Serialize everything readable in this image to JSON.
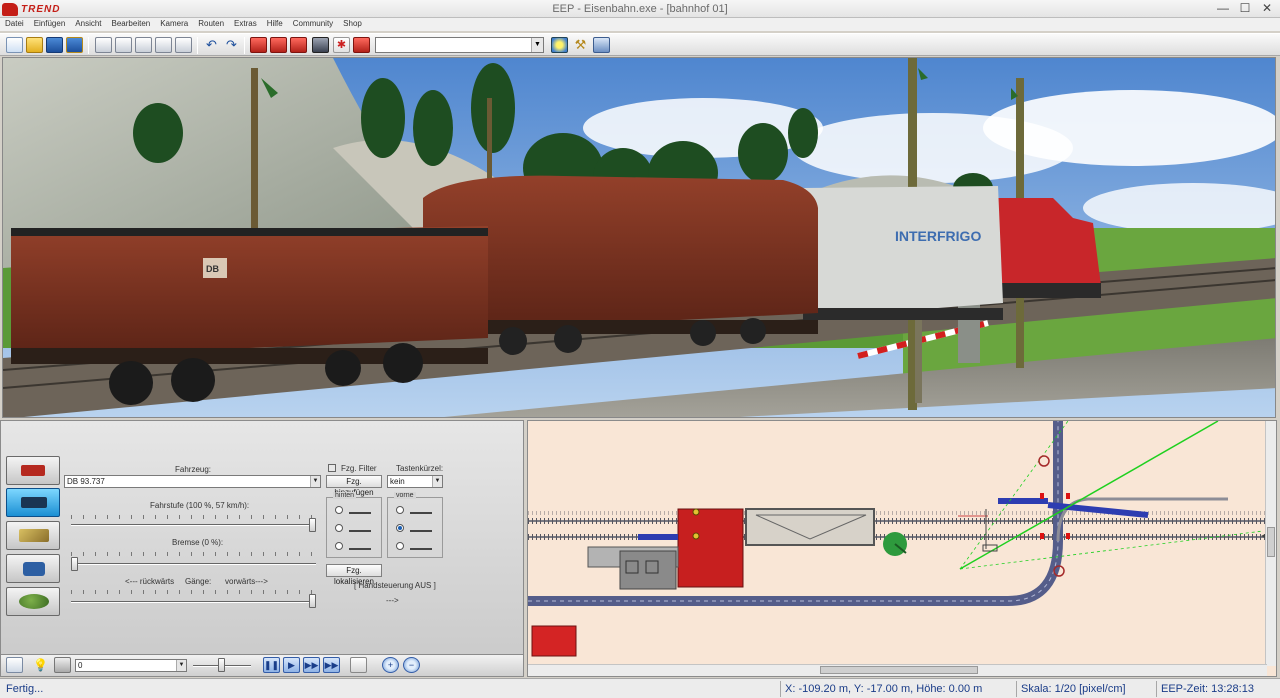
{
  "app": {
    "logo_text": "TREND",
    "window_title": "EEP - Eisenbahn.exe - [bahnhof 01]",
    "window_controls": [
      "—",
      "☐",
      "✕"
    ]
  },
  "menu": [
    "Datei",
    "Einfügen",
    "Ansicht",
    "Bearbeiten",
    "Kamera",
    "Routen",
    "Extras",
    "Hilfe",
    "Community",
    "Shop"
  ],
  "toolbar": {
    "icons": [
      "new-file-icon",
      "open-folder-icon",
      "save-icon",
      "save-as-icon",
      "copy-icon",
      "paste-icon",
      "cut-icon",
      "layers-icon",
      "export-icon",
      "undo-icon",
      "redo-icon",
      "train-red-icon",
      "train-red2-icon",
      "train-red3-icon",
      "locomotive-icon",
      "signal-icon",
      "train-settings-icon",
      "weather-icon",
      "tools-icon",
      "building-icon"
    ],
    "combo_value": ""
  },
  "scene": {
    "wagon_text_interfrigo": "INTERFRIGO",
    "wagon_badge": "DB",
    "colors": {
      "sky": "#8fb7e4",
      "grass": "#5b9a37",
      "wagon_red": "#8b2a1d",
      "loco_red": "#c8262a"
    }
  },
  "control_panel": {
    "mode_buttons": [
      "train-icon",
      "locomotive-mode-icon",
      "crane-icon",
      "camera-icon",
      "tree-icon"
    ],
    "fahrzeug_label": "Fahrzeug:",
    "fahrzeug_value": "DB 93.737",
    "fzg_filter_label": "Fzg. Filter",
    "tastenkuerzel_label": "Tastenkürzel:",
    "tastenkuerzel_value": "kein",
    "fzg_hinzufuegen": "Fzg. hinzufügen",
    "fahrstufe_label": "Fahrstufe (100 %, 57 km/h):",
    "fahrstufe_fraction": 1.0,
    "bremse_label": "Bremse (0 %):",
    "bremse_fraction": 0.0,
    "hinten_label": "hinten",
    "vorne_label": "vorne",
    "rueckwaerts_label": "<--- rückwärts",
    "gaenge_label": "Gänge:",
    "vorwaerts_label": "vorwärts--->",
    "direction_fraction": 1.0,
    "fzg_lokalisieren": "Fzg. lokalisieren",
    "handsteuerung": "[ Handsteuerung AUS ]",
    "arrow_text": "--->"
  },
  "bottom_left": {
    "speed_combo_value": "0"
  },
  "statusbar": {
    "ready": "Fertig...",
    "coords": "X: -109.20 m, Y: -17.00 m, Höhe: 0.00 m",
    "scale": "Skala: 1/20 [pixel/cm]",
    "time": "EEP-Zeit: 13:28:13"
  }
}
